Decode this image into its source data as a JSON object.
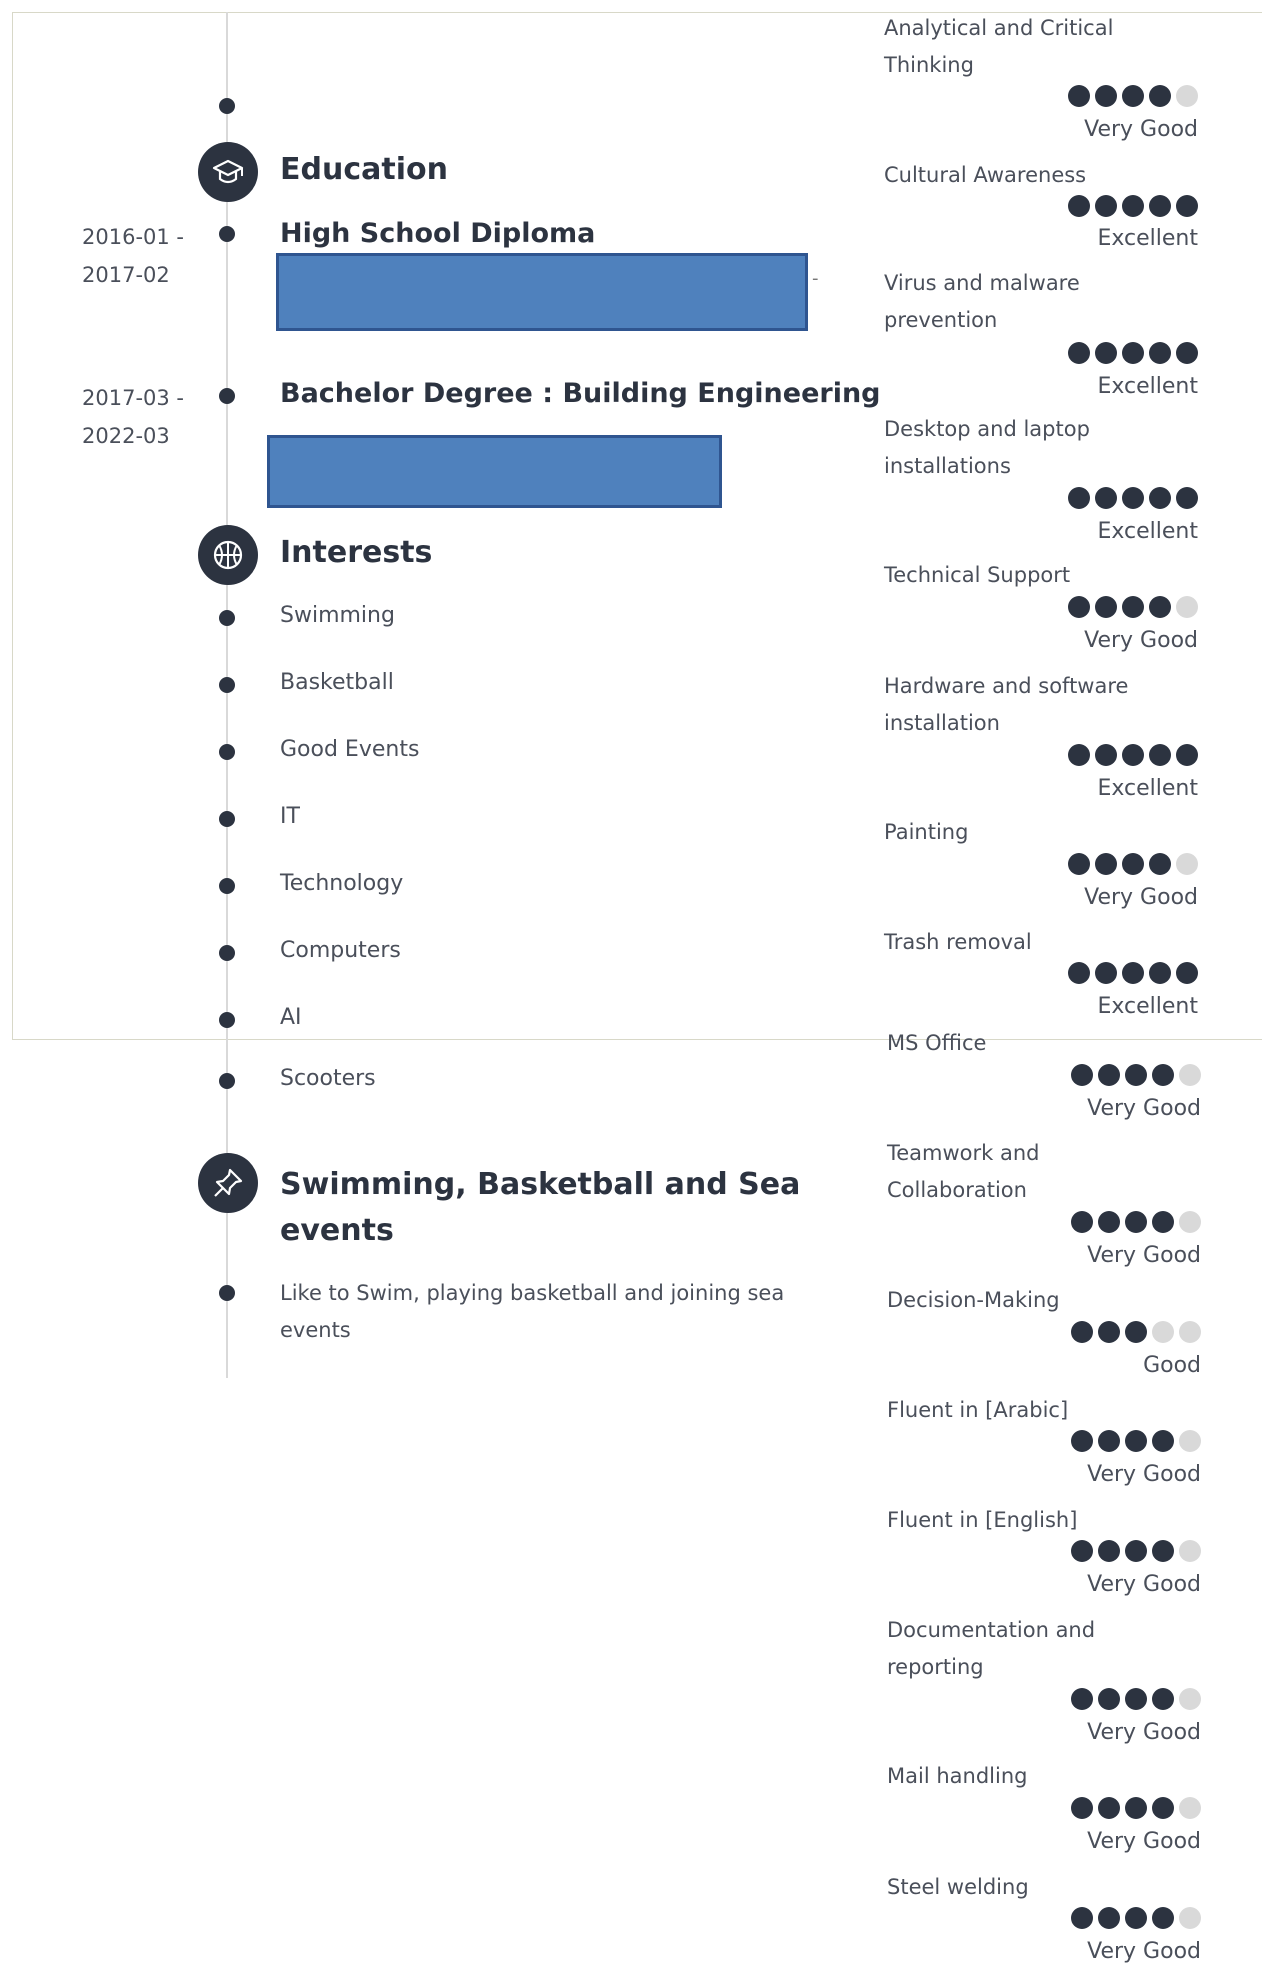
{
  "education": {
    "title": "Education",
    "entries": [
      {
        "date_start": "2016-01 -",
        "date_end": "2017-02",
        "title": "High School Diploma",
        "dash": "-"
      },
      {
        "date_start": "2017-03 -",
        "date_end": "2022-03",
        "title": "Bachelor Degree : Building Engineering"
      }
    ]
  },
  "interests": {
    "title": "Interests",
    "items": [
      "Swimming",
      "Basketball",
      "Good Events",
      "IT",
      "Technology",
      "Computers",
      "AI",
      "Scooters"
    ]
  },
  "activity": {
    "title_line1": "Swimming, Basketball and Sea",
    "title_line2": "events",
    "description": "Like to Swim, playing basketball and joining sea events"
  },
  "skills": [
    {
      "name": "Analytical and Critical Thinking",
      "rating": 4,
      "level": "Very Good"
    },
    {
      "name": "Cultural Awareness",
      "rating": 5,
      "level": "Excellent"
    },
    {
      "name": "Virus and malware prevention",
      "rating": 5,
      "level": "Excellent"
    },
    {
      "name": "Desktop and laptop installations",
      "rating": 5,
      "level": "Excellent"
    },
    {
      "name": "Technical Support",
      "rating": 4,
      "level": "Very Good"
    },
    {
      "name": "Hardware and software installation",
      "rating": 5,
      "level": "Excellent"
    },
    {
      "name": "Painting",
      "rating": 4,
      "level": "Very Good"
    },
    {
      "name": "Trash removal",
      "rating": 5,
      "level": "Excellent"
    },
    {
      "name": "MS Office",
      "rating": 4,
      "level": "Very Good"
    },
    {
      "name": "Teamwork and Collaboration",
      "rating": 4,
      "level": "Very Good"
    },
    {
      "name": "Decision-Making",
      "rating": 3,
      "level": "Good"
    },
    {
      "name": "Fluent in [Arabic]",
      "rating": 4,
      "level": "Very Good"
    },
    {
      "name": "Fluent in [English]",
      "rating": 4,
      "level": "Very Good"
    },
    {
      "name": "Documentation and reporting",
      "rating": 4,
      "level": "Very Good"
    },
    {
      "name": "Mail handling",
      "rating": 4,
      "level": "Very Good"
    },
    {
      "name": "Steel welding",
      "rating": 4,
      "level": "Very Good"
    }
  ],
  "rating_max": 5,
  "colors": {
    "dark": "#2c3340",
    "light_dot": "#d9d9d9",
    "redaction": "#4f81bd"
  }
}
